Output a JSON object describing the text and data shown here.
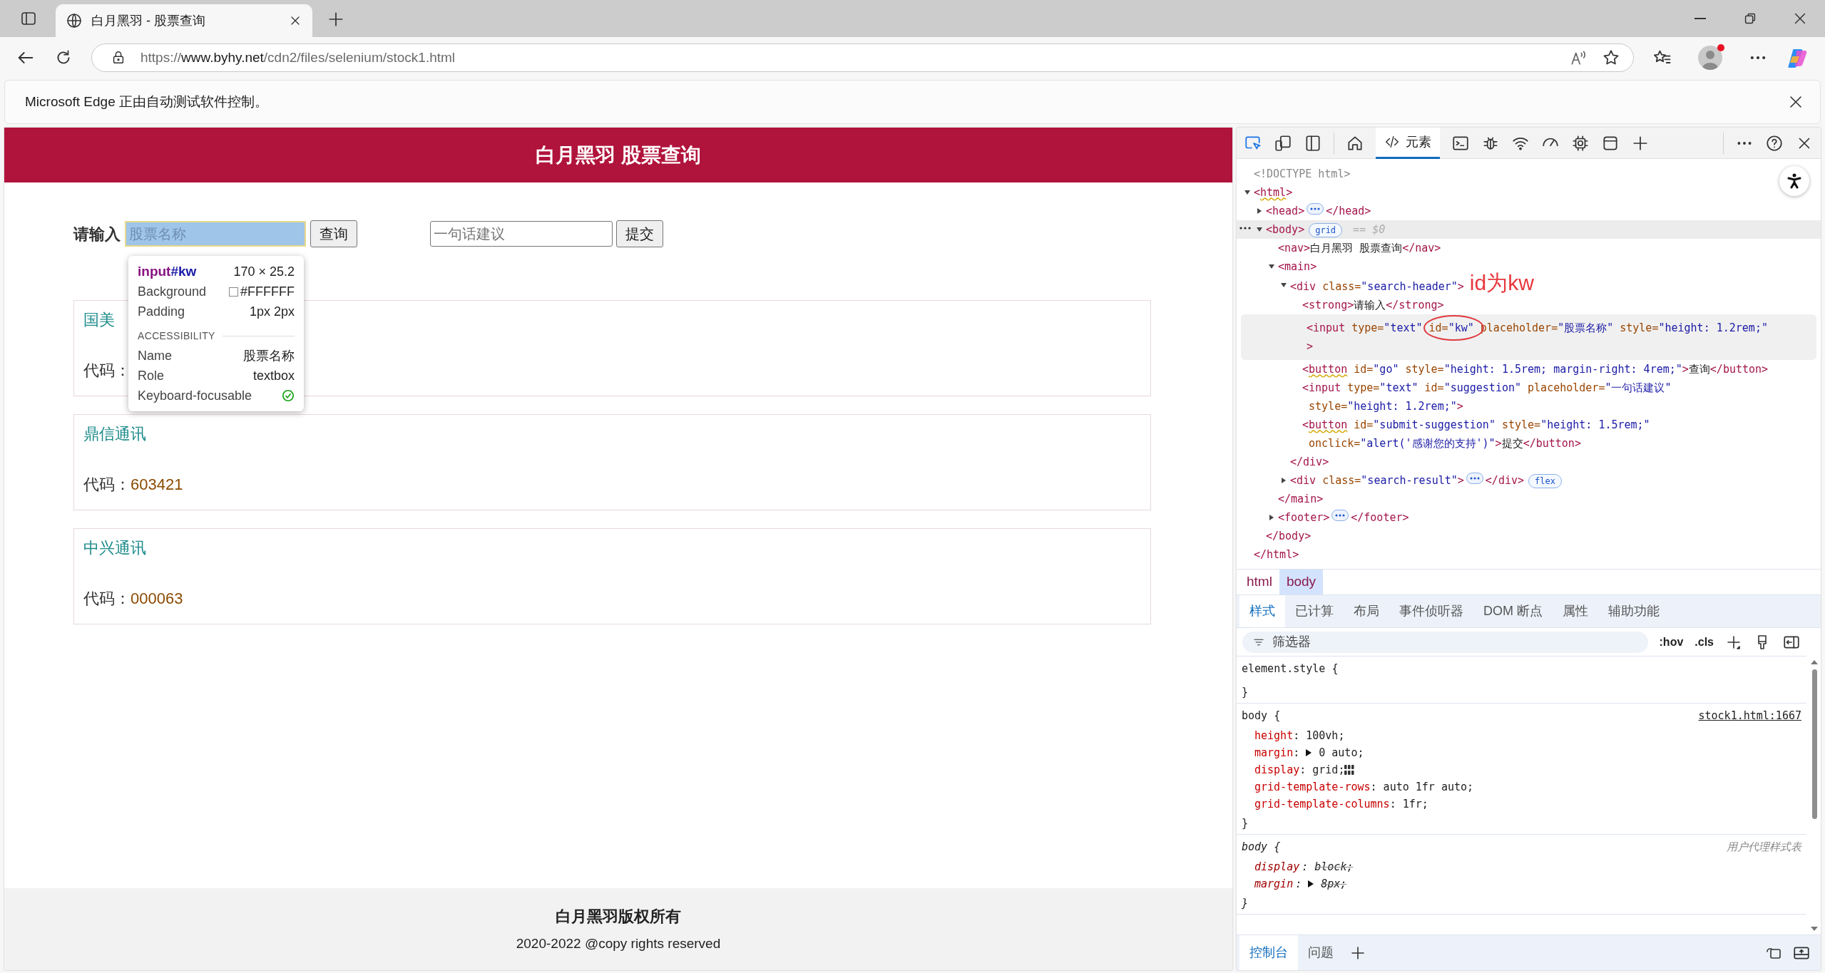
{
  "browser": {
    "tab": {
      "title": "白月黑羽 - 股票查询",
      "selected": true
    },
    "url": {
      "scheme": "https://",
      "host": "www.byhy.net",
      "path": "/cdn2/files/selenium/stock1.html"
    },
    "infobar": "Microsoft Edge 正由自动测试软件控制。"
  },
  "page": {
    "title": "白月黑羽 股票查询",
    "search_label": "请输入",
    "search_field": {
      "placeholder": "股票名称",
      "inspected": true
    },
    "search_button": "查询",
    "suggestion_field": {
      "placeholder": "一句话建议",
      "inspected": false
    },
    "submit_button": "提交",
    "results": [
      {
        "name": "国美",
        "code_label": "代码："
      },
      {
        "name": "鼎信通讯",
        "code_label": "代码：",
        "code": "603421"
      },
      {
        "name": "中兴通讯",
        "code_label": "代码：",
        "code": "000063"
      }
    ],
    "footer": {
      "owner": "白月黑羽版权所有",
      "rights": "2020-2022 @copy rights reserved"
    }
  },
  "inspect_tooltip": {
    "tag": "input",
    "id": "#kw",
    "size": "170 × 25.2",
    "section": "ACCESSIBILITY",
    "style_rows": [
      {
        "label": "Background",
        "value": "#FFFFFF",
        "kind": "swatch"
      },
      {
        "label": "Padding",
        "value": "1px 2px",
        "kind": "plain"
      }
    ],
    "accessibility_rows": [
      {
        "label": "Name",
        "value": "股票名称",
        "kind": "plain"
      },
      {
        "label": "Role",
        "value": "textbox",
        "kind": "plain"
      },
      {
        "label": "Keyboard-focusable",
        "kind": "check"
      }
    ]
  },
  "devtools": {
    "tabs": [
      {
        "label": "元素",
        "selected": true
      }
    ],
    "dom_tree": [
      {
        "tokens": [
          {
            "kind": "doctype",
            "text": "<!DOCTYPE html>"
          }
        ],
        "selected": false,
        "hovered": false
      },
      {
        "tokens": [
          {
            "kind": "tag",
            "text": "<"
          },
          {
            "kind": "tag_flagged",
            "text": "html"
          },
          {
            "kind": "tag",
            "text": ">"
          }
        ],
        "expanded": true,
        "selected": false,
        "hovered": false,
        "end": [
          {
            "kind": "tag",
            "text": "</html>"
          }
        ],
        "children": [
          {
            "tokens": [
              {
                "kind": "tag",
                "text": "<head>"
              },
              {
                "kind": "collapsed"
              },
              {
                "kind": "tag",
                "text": "</head>"
              }
            ],
            "expanded": false,
            "selected": false,
            "hovered": false
          },
          {
            "tokens": [
              {
                "kind": "tag",
                "text": "<body>"
              },
              {
                "kind": "badge",
                "text": "grid"
              },
              {
                "kind": "hint",
                "text": "== $0"
              }
            ],
            "expanded": true,
            "selected": true,
            "hovered": false,
            "end": [
              {
                "kind": "tag",
                "text": "</body>"
              }
            ],
            "children": [
              {
                "tokens": [
                  {
                    "kind": "tag",
                    "text": "<nav>"
                  },
                  {
                    "kind": "text",
                    "text": "白月黑羽 股票查询"
                  },
                  {
                    "kind": "tag",
                    "text": "</nav>"
                  }
                ],
                "selected": false,
                "hovered": false
              },
              {
                "tokens": [
                  {
                    "kind": "tag",
                    "text": "<main>"
                  }
                ],
                "expanded": true,
                "selected": false,
                "hovered": false,
                "end": [
                  {
                    "kind": "tag",
                    "text": "</main>"
                  }
                ],
                "children": [
                  {
                    "tokens": [
                      {
                        "kind": "tag",
                        "text": "<div"
                      },
                      {
                        "kind": "attr",
                        "name": "class=",
                        "value": "\"search-header\""
                      },
                      {
                        "kind": "tag",
                        "text": ">"
                      },
                      {
                        "kind": "annotation",
                        "text": "id为kw"
                      }
                    ],
                    "expanded": true,
                    "selected": false,
                    "hovered": false,
                    "end": [
                      {
                        "kind": "tag",
                        "text": "</div>"
                      }
                    ],
                    "children": [
                      {
                        "tokens": [
                          {
                            "kind": "tag",
                            "text": "<strong>"
                          },
                          {
                            "kind": "text",
                            "text": "请输入"
                          },
                          {
                            "kind": "tag",
                            "text": "</strong>"
                          }
                        ],
                        "selected": false,
                        "hovered": false
                      },
                      {
                        "tokens": [
                          {
                            "kind": "tag",
                            "text": "<input"
                          },
                          {
                            "kind": "attr",
                            "name": "type=",
                            "value": "\"text\""
                          },
                          {
                            "kind": "attr",
                            "name": "id=",
                            "value": "\"kw\"",
                            "circled": true
                          },
                          {
                            "kind": "attr",
                            "name": "placeholder=",
                            "value": "\"股票名称\""
                          },
                          {
                            "kind": "attr",
                            "name": "style=",
                            "value": "\"height: 1.2rem;"
                          },
                          {
                            "kind": "attr_value",
                            "text": "\""
                          },
                          {
                            "kind": "tag",
                            "text": ">"
                          }
                        ],
                        "selected": false,
                        "hovered": true
                      },
                      {
                        "tokens": [
                          {
                            "kind": "tag",
                            "text": "<"
                          },
                          {
                            "kind": "tag_flagged",
                            "text": "button"
                          },
                          {
                            "kind": "attr",
                            "name": "id=",
                            "value": "\"go\""
                          },
                          {
                            "kind": "attr",
                            "name": "style=",
                            "value": "\"height: 1.5rem; margin-right: 4rem;\""
                          },
                          {
                            "kind": "tag",
                            "text": ">"
                          },
                          {
                            "kind": "text",
                            "text": "查询"
                          },
                          {
                            "kind": "tag",
                            "text": "</button>"
                          }
                        ],
                        "selected": false,
                        "hovered": false
                      },
                      {
                        "tokens": [
                          {
                            "kind": "tag",
                            "text": "<input"
                          },
                          {
                            "kind": "attr",
                            "name": "type=",
                            "value": "\"text\""
                          },
                          {
                            "kind": "attr",
                            "name": "id=",
                            "value": "\"suggestion\""
                          },
                          {
                            "kind": "attr",
                            "name": "placeholder=",
                            "value": "\"一句话建议\""
                          },
                          {
                            "kind": "attr",
                            "name": "style=",
                            "value": "\"height: 1.2rem;\""
                          },
                          {
                            "kind": "tag",
                            "text": ">"
                          }
                        ],
                        "selected": false,
                        "hovered": false
                      },
                      {
                        "tokens": [
                          {
                            "kind": "tag",
                            "text": "<"
                          },
                          {
                            "kind": "tag_flagged",
                            "text": "button"
                          },
                          {
                            "kind": "attr",
                            "name": "id=",
                            "value": "\"submit-suggestion\""
                          },
                          {
                            "kind": "attr",
                            "name": "style=",
                            "value": "\"height: 1.5rem;\""
                          },
                          {
                            "kind": "attr",
                            "name": "onclick=",
                            "value": "\"alert('感谢您的支持')\""
                          },
                          {
                            "kind": "tag",
                            "text": ">"
                          },
                          {
                            "kind": "text",
                            "text": "提交"
                          },
                          {
                            "kind": "tag",
                            "text": "</button>"
                          }
                        ],
                        "selected": false,
                        "hovered": false
                      }
                    ]
                  },
                  {
                    "tokens": [
                      {
                        "kind": "tag",
                        "text": "<div"
                      },
                      {
                        "kind": "attr",
                        "name": "class=",
                        "value": "\"search-result\""
                      },
                      {
                        "kind": "tag",
                        "text": ">"
                      },
                      {
                        "kind": "collapsed"
                      },
                      {
                        "kind": "tag",
                        "text": "</div>"
                      },
                      {
                        "kind": "badge",
                        "text": "flex"
                      }
                    ],
                    "expanded": false,
                    "selected": false,
                    "hovered": false
                  }
                ]
              },
              {
                "tokens": [
                  {
                    "kind": "tag",
                    "text": "<footer>"
                  },
                  {
                    "kind": "collapsed"
                  },
                  {
                    "kind": "tag",
                    "text": "</footer>"
                  }
                ],
                "expanded": false,
                "selected": false,
                "hovered": false
              }
            ]
          }
        ]
      }
    ],
    "breadcrumbs": [
      {
        "label": "html",
        "selected": false
      },
      {
        "label": "body",
        "selected": true
      }
    ],
    "panel_tabs": [
      {
        "label": "样式",
        "selected": true
      },
      {
        "label": "已计算",
        "selected": false
      },
      {
        "label": "布局",
        "selected": false
      },
      {
        "label": "事件侦听器",
        "selected": false
      },
      {
        "label": "DOM 断点",
        "selected": false
      },
      {
        "label": "属性",
        "selected": false
      },
      {
        "label": "辅助功能",
        "selected": false
      }
    ],
    "filter": {
      "placeholder": "筛选器"
    },
    "hov": ":hov",
    "cls": ".cls",
    "rules": [
      {
        "selector": "element.style {",
        "kind": "inline",
        "close": "}"
      },
      {
        "selector": "body {",
        "kind": "author",
        "source": "stock1.html:1667",
        "close": "}",
        "declarations": [
          {
            "prop": "height",
            "colon": ":",
            "value": "100vh;",
            "kind": "plain",
            "overridden": false
          },
          {
            "prop": "margin",
            "colon": ":",
            "value": "0 auto;",
            "kind": "shorthand",
            "overridden": false
          },
          {
            "prop": "display",
            "colon": ":",
            "value": "grid;",
            "kind": "grid",
            "overridden": false
          },
          {
            "prop": "grid-template-rows",
            "colon": ":",
            "value": "auto 1fr auto;",
            "kind": "plain",
            "overridden": false
          },
          {
            "prop": "grid-template-columns",
            "colon": ":",
            "value": "1fr;",
            "kind": "plain",
            "overridden": false
          }
        ]
      },
      {
        "selector": "body {",
        "kind": "useragent",
        "source": "用户代理样式表",
        "close": "}",
        "declarations": [
          {
            "prop": "display",
            "colon": ":",
            "value": "block;",
            "kind": "plain",
            "overridden": true
          },
          {
            "prop": "margin",
            "colon": ":",
            "value": "8px;",
            "kind": "shorthand",
            "overridden": true
          }
        ]
      }
    ],
    "drawer_tabs": [
      {
        "label": "控制台",
        "selected": true
      },
      {
        "label": "问题",
        "selected": false
      }
    ]
  }
}
